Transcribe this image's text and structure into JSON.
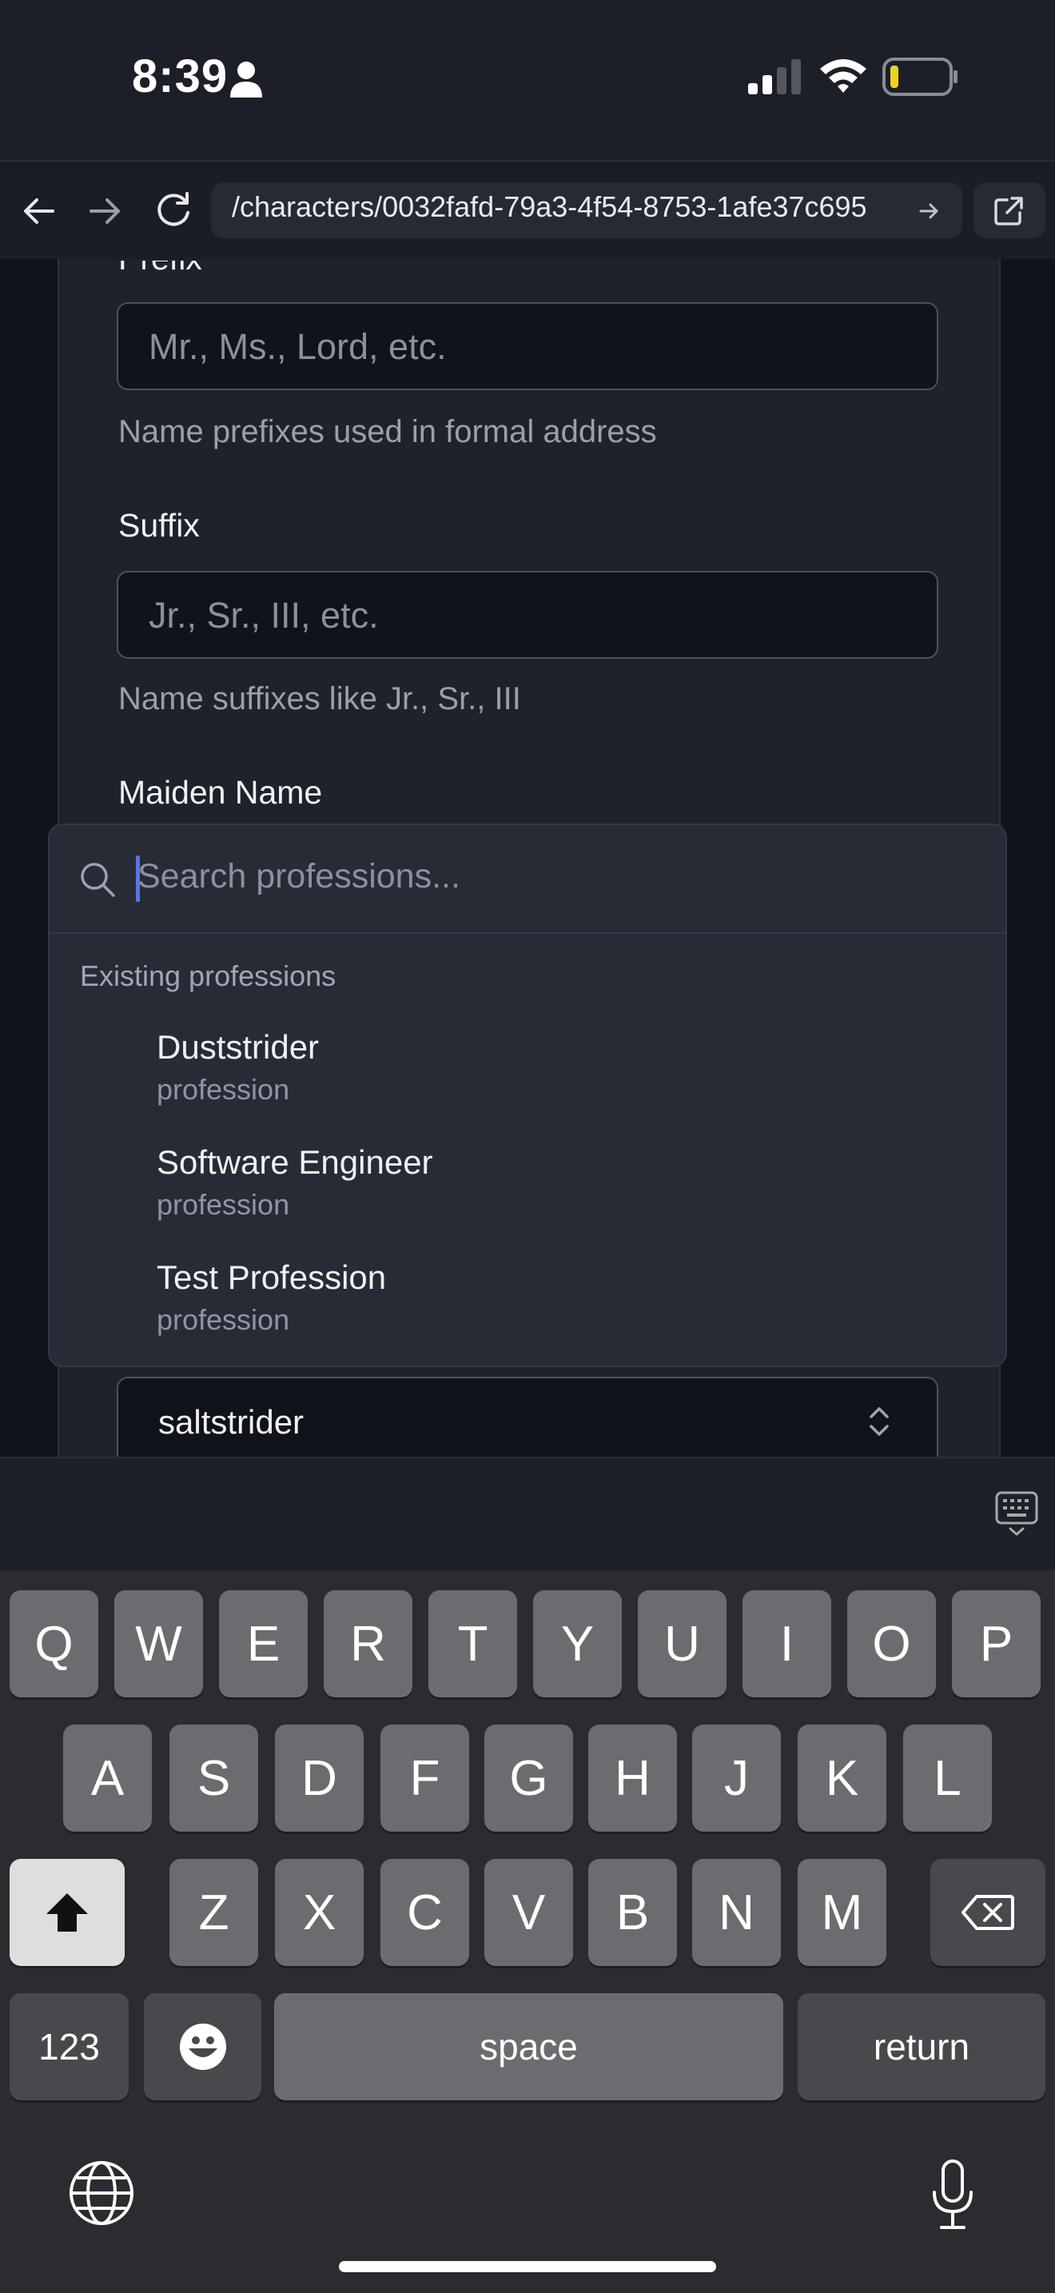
{
  "status_bar": {
    "time": "8:39"
  },
  "browser": {
    "url": "/characters/0032fafd-79a3-4f54-8753-1afe37c695"
  },
  "form": {
    "prefix_label": "Prefix",
    "prefix_placeholder": "Mr., Ms., Lord, etc.",
    "prefix_help": "Name prefixes used in formal address",
    "suffix_label": "Suffix",
    "suffix_placeholder": "Jr., Sr., III, etc.",
    "suffix_help": "Name suffixes like Jr., Sr., III",
    "maiden_label": "Maiden Name"
  },
  "popover": {
    "search_placeholder": "Search professions...",
    "group_label": "Existing professions",
    "items": [
      {
        "name": "Duststrider",
        "type": "profession"
      },
      {
        "name": "Software Engineer",
        "type": "profession"
      },
      {
        "name": "Test Profession",
        "type": "profession"
      }
    ]
  },
  "select": {
    "value": "saltstrider"
  },
  "keyboard": {
    "row1": [
      "Q",
      "W",
      "E",
      "R",
      "T",
      "Y",
      "U",
      "I",
      "O",
      "P"
    ],
    "row2": [
      "A",
      "S",
      "D",
      "F",
      "G",
      "H",
      "J",
      "K",
      "L"
    ],
    "row3": [
      "Z",
      "X",
      "C",
      "V",
      "B",
      "N",
      "M"
    ],
    "numbers_key": "123",
    "space_key": "space",
    "return_key": "return"
  }
}
